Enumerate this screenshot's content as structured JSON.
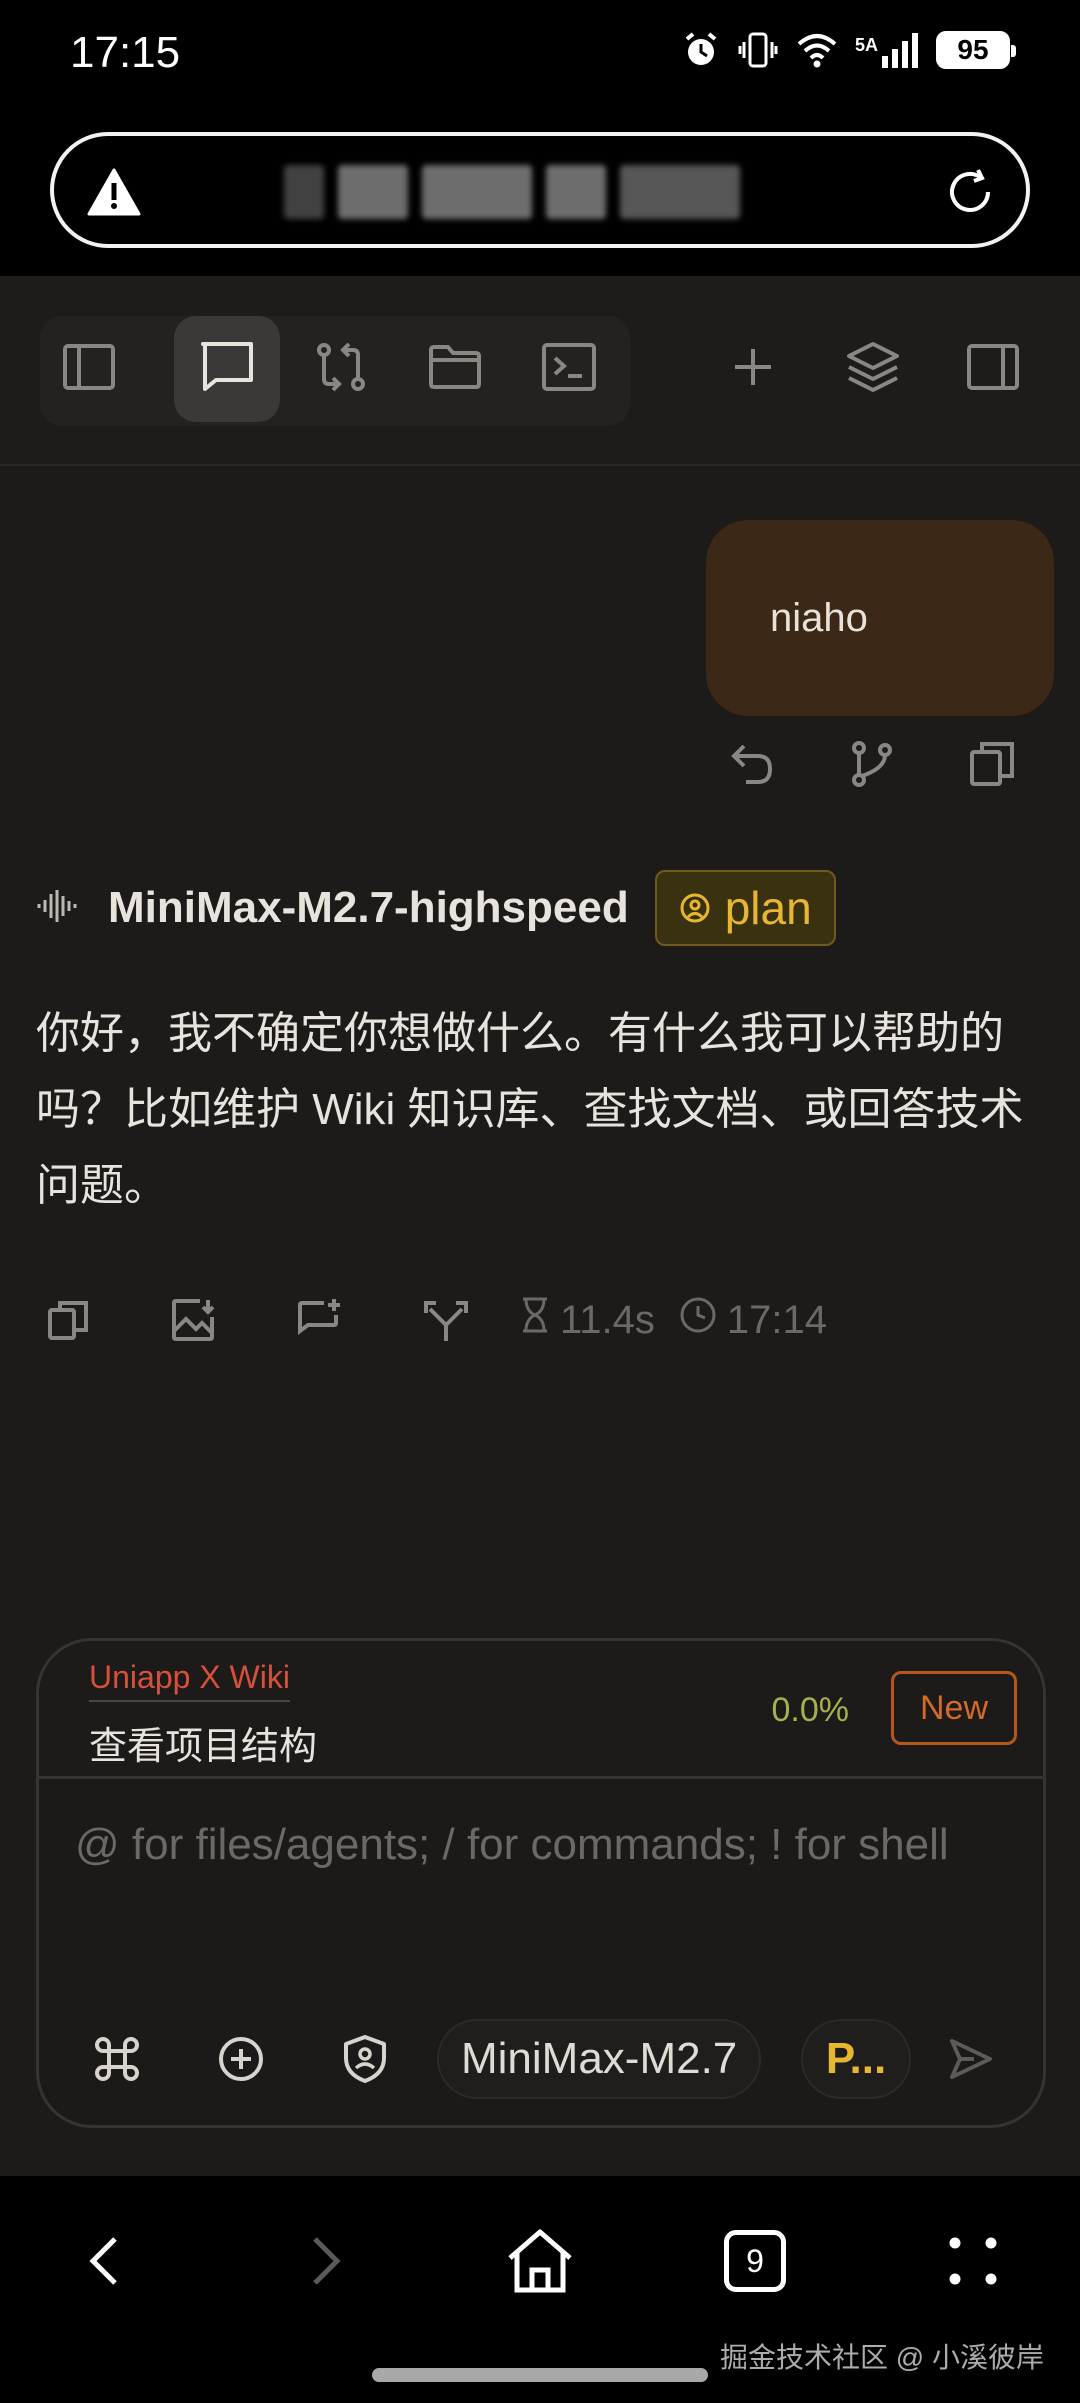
{
  "status_bar": {
    "time": "17:15",
    "network_label": "5A",
    "battery": "95",
    "icons": [
      "alarm-icon",
      "vibrate-icon",
      "wifi-icon",
      "signal-icon",
      "battery-icon"
    ]
  },
  "address_bar": {
    "warning_icon": "warning-triangle-icon",
    "reload_icon": "reload-icon"
  },
  "toolbar": {
    "left": [
      {
        "name": "sidebar-toggle-icon",
        "active": false
      },
      {
        "name": "chat-icon",
        "active": true
      },
      {
        "name": "git-compare-icon",
        "active": false
      },
      {
        "name": "folder-icon",
        "active": false
      },
      {
        "name": "terminal-icon",
        "active": false
      }
    ],
    "right": [
      "plus-icon",
      "layers-icon",
      "right-panel-icon"
    ]
  },
  "conversation": {
    "user_message": "niaho",
    "user_actions": [
      "undo-icon",
      "branch-icon",
      "copy-icon"
    ],
    "assistant": {
      "model": "MiniMax-M2.7-highspeed",
      "mode": "plan",
      "reply": "你好，我不确定你想做什么。有什么我可以帮助的吗？比如维护 Wiki 知识库、查找文档、或回答技术问题。",
      "actions": [
        "copy-icon",
        "image-download-icon",
        "comment-add-icon",
        "fork-icon"
      ],
      "duration": "11.4s",
      "time": "17:14"
    }
  },
  "composer": {
    "project": "Uniapp X Wiki",
    "task": "查看项目结构",
    "progress": "0.0%",
    "new_label": "New",
    "placeholder": "@ for files/agents; / for commands; ! for shell",
    "model_chip": "MiniMax-M2.7",
    "mode_chip": "P...",
    "tools": [
      "command-icon",
      "add-circle-icon",
      "shield-user-icon",
      "send-icon"
    ]
  },
  "browser_nav": {
    "tabs_count": "9",
    "icons": [
      "back-icon",
      "forward-icon",
      "home-icon",
      "tabs-icon",
      "menu-dots-icon"
    ]
  },
  "watermark": "掘金技术社区 @ 小溪彼岸"
}
